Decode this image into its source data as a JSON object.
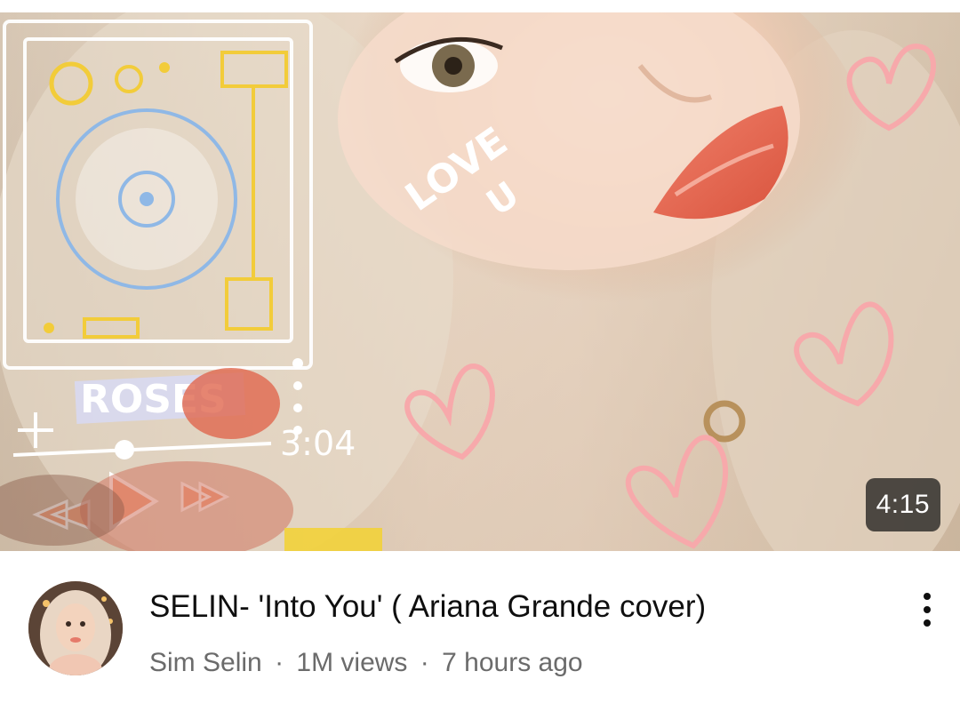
{
  "video": {
    "duration": "4:15",
    "title": "SELIN- 'Into You' ( Ariana Grande cover)",
    "channel": "Sim Selin",
    "views": "1M views",
    "age": "7 hours ago",
    "separator": "·"
  },
  "thumbnail_art": {
    "cheek_text_1": "LOVE",
    "cheek_text_2": "U",
    "label_text": "ROSES",
    "player_time": "3:04"
  },
  "icons": {
    "more_menu": "vertical-ellipsis-icon"
  }
}
